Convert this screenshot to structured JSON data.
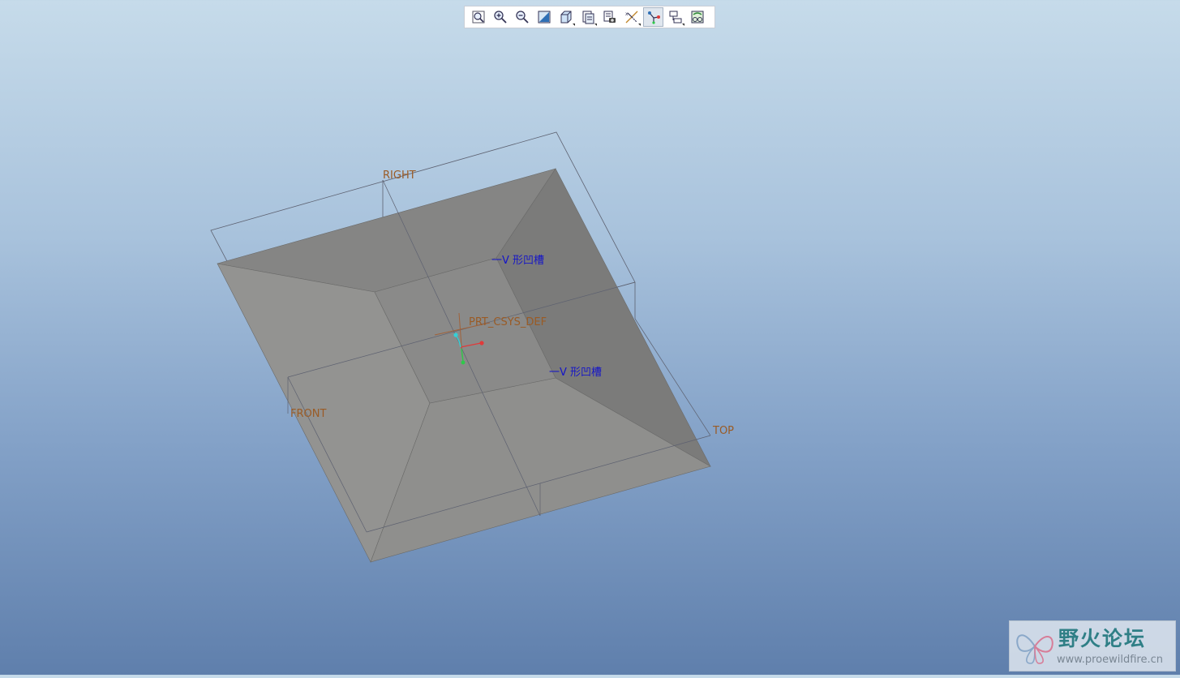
{
  "toolbar": {
    "buttons": [
      {
        "name": "refit-icon",
        "active": false,
        "dropdown": false
      },
      {
        "name": "zoom-in-icon",
        "active": false,
        "dropdown": false
      },
      {
        "name": "zoom-out-icon",
        "active": false,
        "dropdown": false
      },
      {
        "name": "repaint-icon",
        "active": false,
        "dropdown": false
      },
      {
        "name": "display-style-icon",
        "active": false,
        "dropdown": true
      },
      {
        "name": "saved-orientations-icon",
        "active": false,
        "dropdown": true
      },
      {
        "name": "view-manager-icon",
        "active": false,
        "dropdown": false
      },
      {
        "name": "datum-display-icon",
        "active": false,
        "dropdown": true
      },
      {
        "name": "csys-display-icon",
        "active": true,
        "dropdown": false
      },
      {
        "name": "annotation-display-icon",
        "active": false,
        "dropdown": true
      },
      {
        "name": "spin-center-icon",
        "active": false,
        "dropdown": false
      }
    ]
  },
  "model": {
    "plane_labels": {
      "right": "RIGHT",
      "front": "FRONT",
      "top": "TOP"
    },
    "csys_label": "PRT_CSYS_DEF",
    "feature_labels": [
      "一V 形凹槽",
      "一V 形凹槽"
    ],
    "colors": {
      "face_left": "#939391",
      "face_top": "#858584",
      "face_right": "#7b7b7a",
      "face_bottom": "#8f8f8d",
      "face_floor": "#8a8a89",
      "plane_label": "#9a5b25",
      "feature_label": "#1414c8",
      "csys_x": "#e03a3a",
      "csys_y": "#2fc94a",
      "csys_z": "#35cfd6"
    }
  },
  "watermark": {
    "title": "野火论坛",
    "url": "www.proewildfire.cn"
  }
}
